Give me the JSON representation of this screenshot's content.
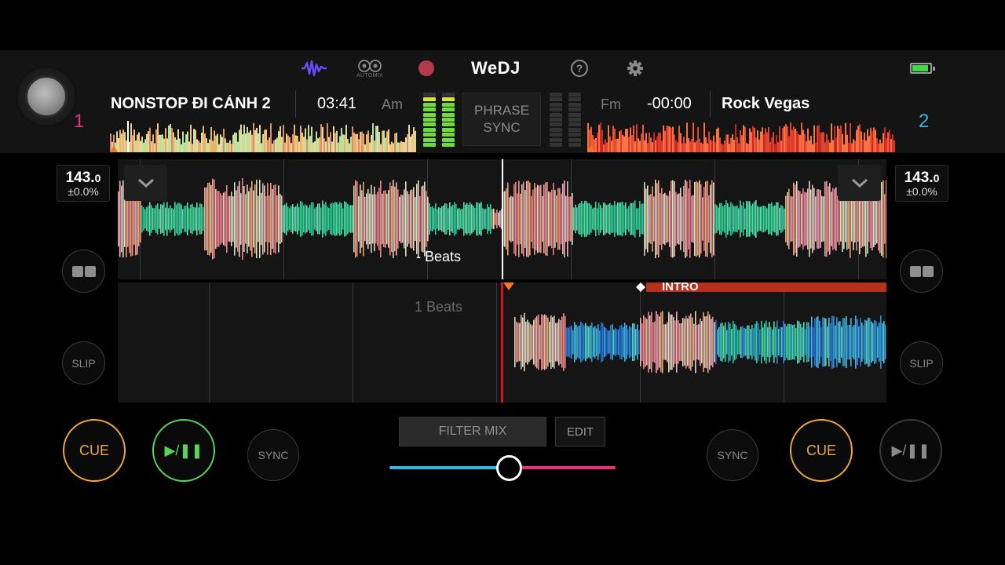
{
  "app": {
    "brand": "WeDJ",
    "automix_label": "AUTOMIX"
  },
  "header_icons": [
    "waveform-icon",
    "automix-icon",
    "record-icon",
    "help-icon",
    "settings-icon",
    "battery-icon"
  ],
  "colors": {
    "deck1_accent": "#ec2f7c",
    "deck2_accent": "#35b7e8",
    "cue": "#f0a83e",
    "play_active": "#58d556",
    "intro_marker": "#b6311a",
    "brand_purple": "#6a4cff"
  },
  "deck1": {
    "number": "1",
    "title": "NONSTOP ĐI CẢNH 2",
    "time": "03:41",
    "key": "Am",
    "bpm_main": "143.",
    "bpm_decimal": "0",
    "pitch": "±0.0%",
    "beats_label": "- Beats",
    "slip": "SLIP",
    "cue": "CUE",
    "play": "▶/❚❚",
    "sync": "SYNC"
  },
  "deck2": {
    "number": "2",
    "title": "Rock Vegas",
    "time": "-00:00",
    "key": "Fm",
    "bpm_main": "143.",
    "bpm_decimal": "0",
    "pitch": "±0.0%",
    "beats_label": "1 Beats",
    "intro": "INTRO",
    "slip": "SLIP",
    "cue": "CUE",
    "play": "▶/❚❚",
    "sync": "SYNC"
  },
  "mixer": {
    "phrase_sync_line1": "PHRASE",
    "phrase_sync_line2": "SYNC",
    "filter_mix": "FILTER MIX",
    "edit": "EDIT",
    "crossfader_position": 0.53,
    "deck1_level_lit": 10,
    "deck2_level_lit": 0,
    "meter_segments": 11
  }
}
